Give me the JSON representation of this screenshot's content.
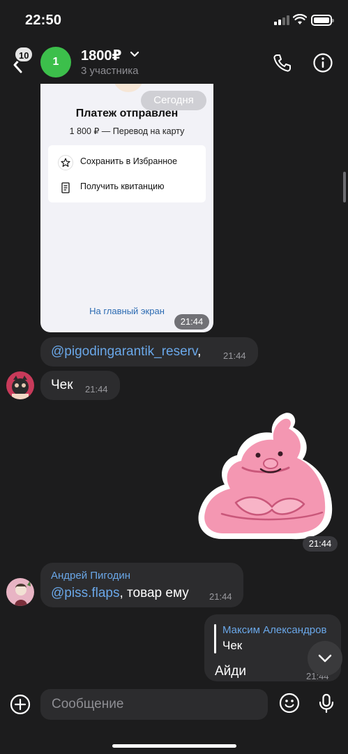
{
  "status_bar": {
    "time": "22:50"
  },
  "header": {
    "unread_count": "10",
    "avatar_letter": "1",
    "title": "1800₽",
    "subtitle": "3 участника"
  },
  "screenshot": {
    "date_pill": "Сегодня",
    "title": "Платеж отправлен",
    "subtitle": "1 800 ₽ — Перевод на карту",
    "action_save": "Сохранить в Избранное",
    "action_receipt": "Получить квитанцию",
    "home_link": "На главный экран",
    "time": "21:44"
  },
  "messages": [
    {
      "mention": "@pigodingarantik_reserv",
      "text": ",",
      "time": "21:44"
    },
    {
      "text": "Чек",
      "time": "21:44"
    },
    {
      "sticker_time": "21:44"
    },
    {
      "author": "Андрей Пигодин",
      "mention": "@piss.flaps",
      "text": ", товар ему",
      "time": "21:44"
    },
    {
      "reply_author": "Максим Александров",
      "reply_text": "Чек",
      "text": "Айди",
      "time": "21:44"
    }
  ],
  "input": {
    "placeholder": "Сообщение"
  },
  "colors": {
    "accent": "#6aa7e8",
    "avatar_green": "#3cbf4b",
    "background": "#1c1c1d",
    "bubble": "#2c2c2e"
  }
}
